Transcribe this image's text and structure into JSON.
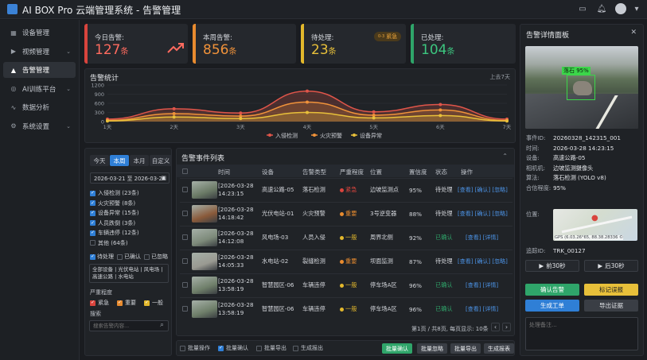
{
  "app": {
    "title": "AI BOX Pro 云端管理系统 - 告警管理"
  },
  "sidebar": {
    "items": [
      {
        "label": "设备管理",
        "icon": "grid-icon"
      },
      {
        "label": "视频管理",
        "icon": "video-icon",
        "chevron": true
      },
      {
        "label": "告警管理",
        "icon": "warning-icon",
        "active": true
      },
      {
        "label": "AI训练平台",
        "icon": "ai-icon",
        "chevron": true
      },
      {
        "label": "数据分析",
        "icon": "chart-icon"
      },
      {
        "label": "系统设置",
        "icon": "gear-icon",
        "chevron": true
      }
    ]
  },
  "stats": {
    "today": {
      "label": "今日告警:",
      "value": "127",
      "unit": "条",
      "color": "#d9443d"
    },
    "week": {
      "label": "本周告警:",
      "value": "856",
      "unit": "条",
      "color": "#e88b2f"
    },
    "pending": {
      "label": "待处理:",
      "value": "23",
      "unit": "条",
      "color": "#e3b82c",
      "badge": "紧急",
      "badge_count": "0-3"
    },
    "done": {
      "label": "已处理:",
      "value": "104",
      "unit": "条",
      "color": "#2fa56a"
    }
  },
  "chart_panel": {
    "title": "告警统计",
    "range": "上去7天"
  },
  "chart_data": {
    "type": "area",
    "categories": [
      "1天",
      "2天",
      "3天",
      "4天",
      "5天",
      "6天",
      "7天"
    ],
    "ylim": [
      0,
      1200
    ],
    "yticks": [
      "1200",
      "900",
      "600",
      "300",
      "0"
    ],
    "series": [
      {
        "name": "入侵检测",
        "color": "#e0554a",
        "values": [
          80,
          420,
          280,
          1000,
          320,
          560,
          80
        ]
      },
      {
        "name": "火灾预警",
        "color": "#f0923a",
        "values": [
          40,
          260,
          180,
          640,
          210,
          380,
          40
        ]
      },
      {
        "name": "设备异常",
        "color": "#e8c03a",
        "values": [
          20,
          150,
          100,
          300,
          120,
          200,
          20
        ]
      }
    ]
  },
  "filters": {
    "tabs": [
      "今天",
      "本周",
      "本月",
      "自定义"
    ],
    "date_range": "2026-03-21 至 2026-03-28",
    "types": [
      {
        "label": "入侵检测 (23条)",
        "checked": true
      },
      {
        "label": "火灾预警 (8条)",
        "checked": true
      },
      {
        "label": "设备异常 (15条)",
        "checked": true
      },
      {
        "label": "人员跌倒 (3条)",
        "checked": true
      },
      {
        "label": "车辆违停 (12条)",
        "checked": true
      },
      {
        "label": "其他 (64条)",
        "checked": false
      }
    ],
    "status": [
      {
        "label": "待处理",
        "checked": true
      },
      {
        "label": "已确认",
        "checked": false
      },
      {
        "label": "已忽略",
        "checked": false
      }
    ],
    "devices": "全部设备 | 光伏电站 | 风电场 | 高速公路 | 水电站",
    "severity_title": "严重程度",
    "severity": [
      {
        "label": "紧急",
        "cls": "r"
      },
      {
        "label": "重要",
        "cls": "o"
      },
      {
        "label": "一般",
        "cls": "y"
      }
    ],
    "search_title": "搜索",
    "search_placeholder": "搜索告警内容..."
  },
  "table": {
    "title": "告警事件列表",
    "headers": [
      "时间",
      "设备",
      "告警类型",
      "严重程度",
      "位置",
      "置信度",
      "状态",
      "操作"
    ],
    "rows": [
      {
        "time1": "[2026-03-28",
        "time2": "14:23:15",
        "device": "高速公路-05",
        "type": "落石检测",
        "level": "紧急",
        "lc": "#d9443d",
        "loc": "边坡监测点",
        "conf": "95%",
        "status": "待处理",
        "sc": "#d3d6db",
        "ops": "[查看] [确认] [忽略]",
        "thumb": "#6b7a66"
      },
      {
        "time1": "[2026-03-28",
        "time2": "14:18:42",
        "device": "光伏电站-01",
        "type": "火灾预警",
        "level": "重要",
        "lc": "#e88b2f",
        "loc": "3号逆变器",
        "conf": "88%",
        "status": "待处理",
        "sc": "#d3d6db",
        "ops": "[查看] [确认] [忽略]",
        "thumb": "#8a5a3a"
      },
      {
        "time1": "[2026-03-28",
        "time2": "14:12:08",
        "device": "风电场-03",
        "type": "人员入侵",
        "level": "一般",
        "lc": "#e3b82c",
        "loc": "周界北侧",
        "conf": "92%",
        "status": "已确认",
        "sc": "#2fa56a",
        "ops": "[查看] [详情]",
        "thumb": "#7d8a7a"
      },
      {
        "time1": "[2026-03-28",
        "time2": "14:05:33",
        "device": "水电站-02",
        "type": "裂缝检测",
        "level": "重要",
        "lc": "#e88b2f",
        "loc": "坝面监测",
        "conf": "87%",
        "status": "待处理",
        "sc": "#d3d6db",
        "ops": "[查看] [确认] [忽略]",
        "thumb": "#9a9a92"
      },
      {
        "time1": "[2026-03-28",
        "time2": "13:58:19",
        "device": "智慧园区-06",
        "type": "车辆违停",
        "level": "一般",
        "lc": "#e3b82c",
        "loc": "停车场A区",
        "conf": "96%",
        "status": "已确认",
        "sc": "#2fa56a",
        "ops": "[查看] [详情]",
        "thumb": "#6f7f6a"
      },
      {
        "time1": "[2026-03-28",
        "time2": "13:58:19",
        "device": "智慧园区-06",
        "type": "车辆违停",
        "level": "一般",
        "lc": "#e3b82c",
        "loc": "停车场A区",
        "conf": "96%",
        "status": "已确认",
        "sc": "#2fa56a",
        "ops": "[查看] [详情]",
        "thumb": "#6f7f6a"
      }
    ],
    "pagination": "第1页 / 共8页, 每页显示: 10条"
  },
  "bulk": {
    "items": [
      {
        "label": "批量操作",
        "checked": false
      },
      {
        "label": "批量确认",
        "checked": true
      },
      {
        "label": "批量导出",
        "checked": false
      },
      {
        "label": "生成报出",
        "checked": false
      }
    ],
    "buttons": [
      "批量确认",
      "批量忽略",
      "批量导出",
      "生成报表"
    ]
  },
  "detail": {
    "title": "告警详情面板",
    "detect_label": "落石 95%",
    "fields": [
      {
        "k": "事件ID:",
        "v": "20260328_142315_001"
      },
      {
        "k": "时间:",
        "v": "2026-03-28 14:23:15"
      },
      {
        "k": "设备:",
        "v": "高速公路-05"
      },
      {
        "k": "相机机:",
        "v": "边坡监测摄像头"
      },
      {
        "k": "算法:",
        "v": "落石检测 (YOLO v8)"
      },
      {
        "k": "合信程度:",
        "v": "95%"
      }
    ],
    "location_label": "位置:",
    "gps": "GPS (6.03.26°65, 88.38.28336 ©",
    "track_label": "追踪ID:",
    "track": "TRK_00127",
    "prev": "前30秒",
    "next": "后30秒",
    "confirm": "确认告警",
    "mark": "标记误报",
    "ticket": "生成工单",
    "export": "导出证据",
    "note_placeholder": "处理备注..."
  }
}
